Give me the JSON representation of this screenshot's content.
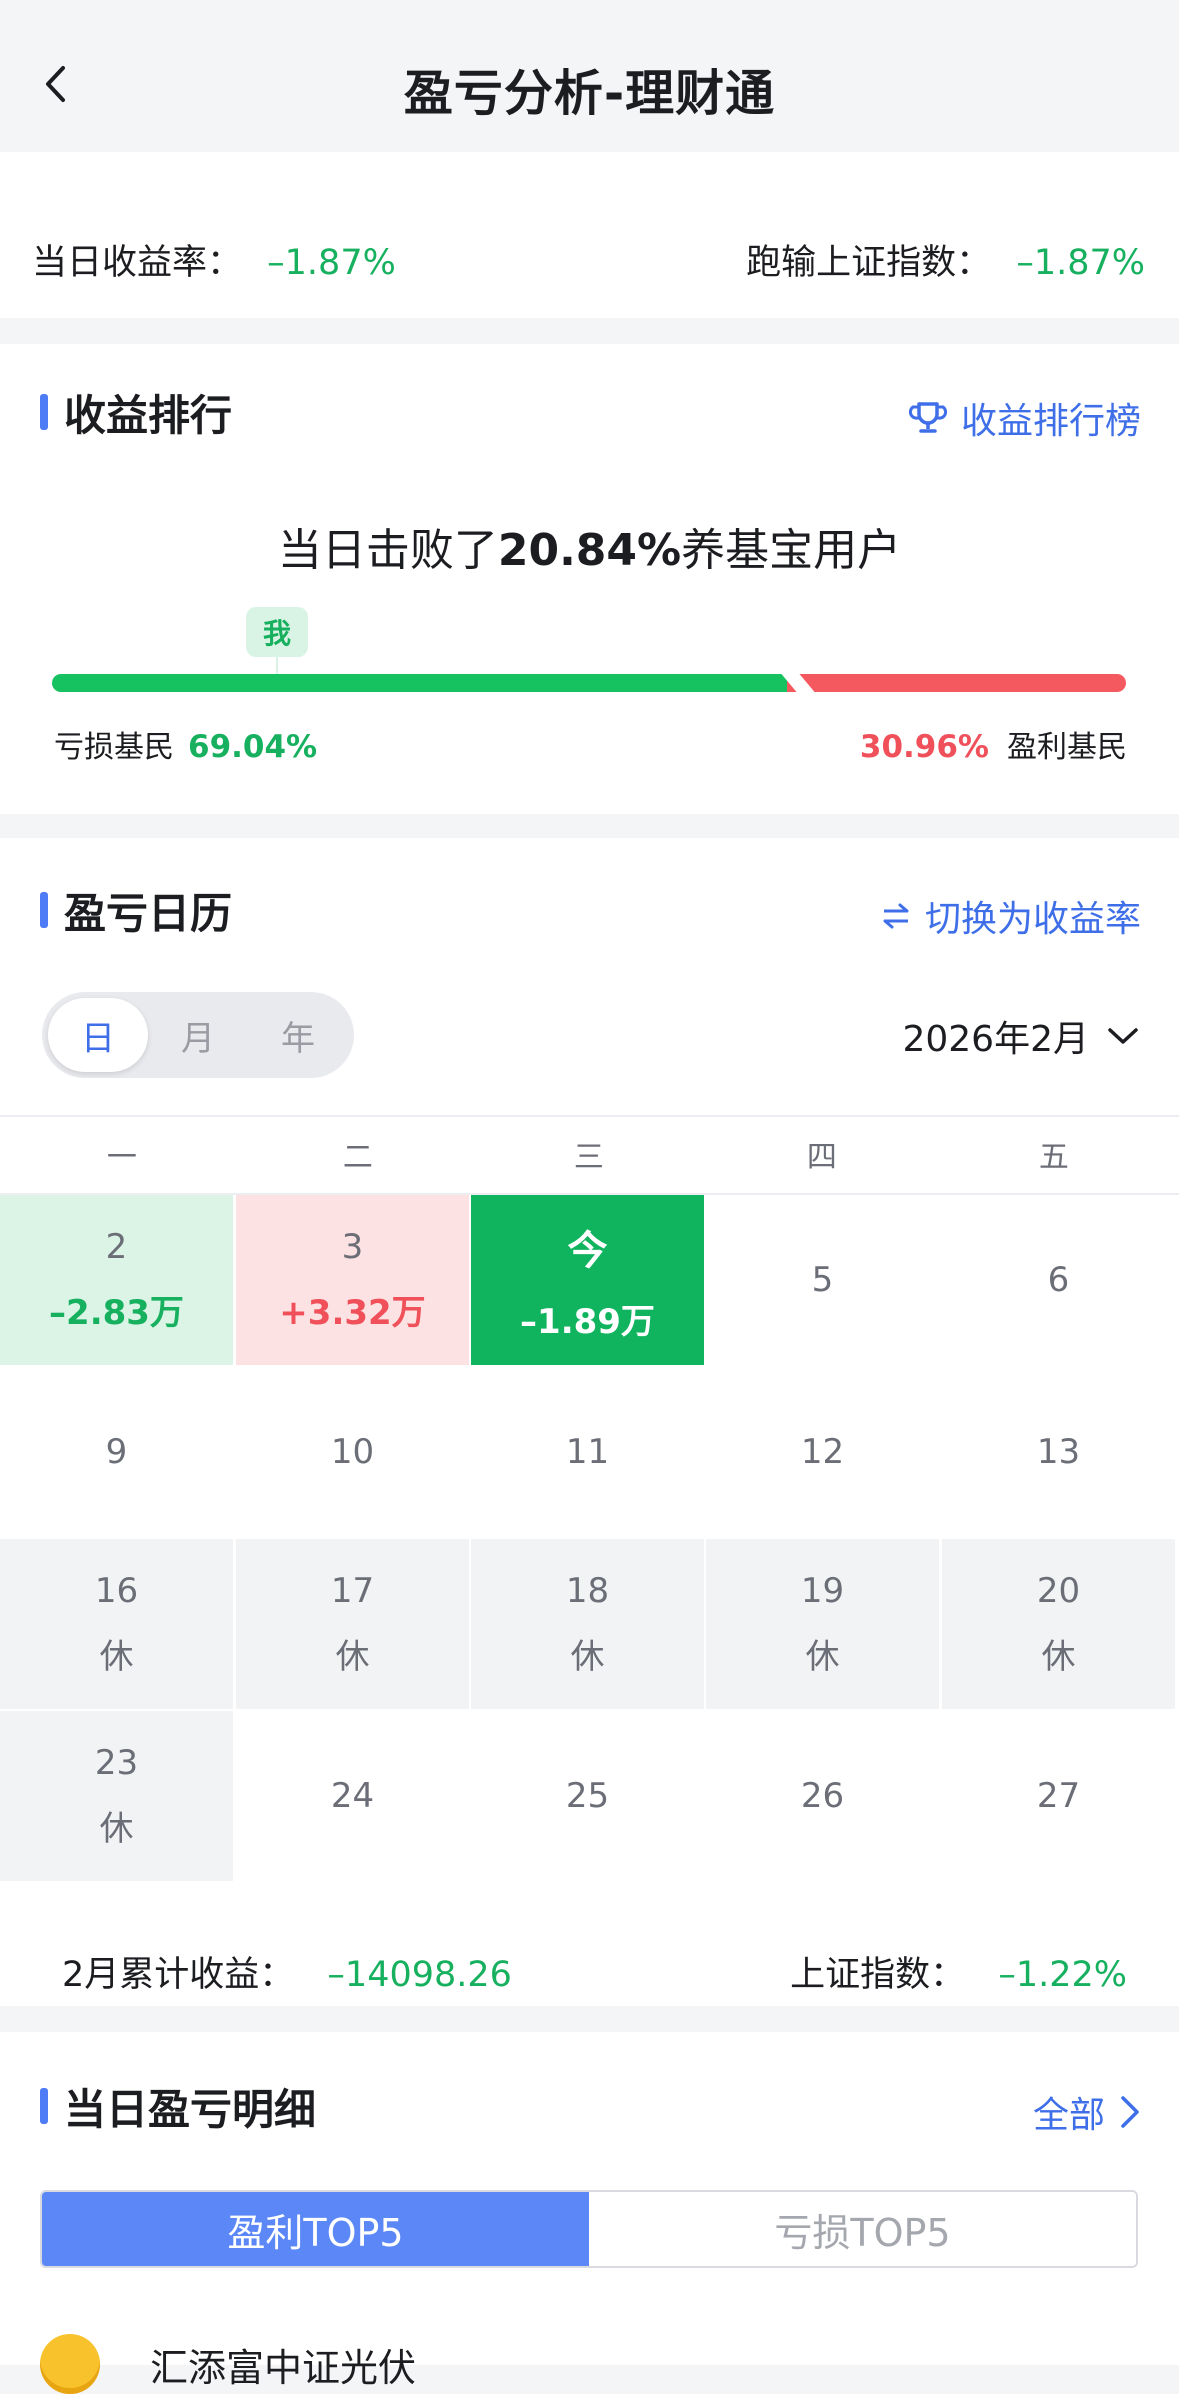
{
  "nav": {
    "title": "盈亏分析-理财通",
    "back_icon": "chevron-left-icon"
  },
  "summary": {
    "daily_rate_label": "当日收益率：",
    "daily_rate_value": "–1.87%",
    "vs_index_label": "跑输上证指数：",
    "vs_index_value": "–1.87%"
  },
  "ranking": {
    "title": "收益排行",
    "link_label": "收益排行榜",
    "link_icon": "trophy-icon",
    "headline_prefix": "当日击败了",
    "headline_percent": "20.84%",
    "headline_suffix": "养基宝用户",
    "me_tag": "我",
    "loss_label": "亏损基民",
    "loss_value": "69.04%",
    "loss_fraction": 0.6904,
    "profit_value": "30.96%",
    "profit_label": "盈利基民",
    "me_fraction": 0.2084
  },
  "calendar": {
    "title": "盈亏日历",
    "switch_label": "切换为收益率",
    "switch_icon": "swap-arrows-icon",
    "modes": [
      "日",
      "月",
      "年"
    ],
    "active_mode": "日",
    "month": "2026年2月",
    "weekdays": [
      "一",
      "二",
      "三",
      "四",
      "五"
    ],
    "weeks": [
      [
        {
          "day": "2",
          "sub": "–2.83万",
          "type": "loss"
        },
        {
          "day": "3",
          "sub": "+3.32万",
          "type": "gain"
        },
        {
          "day": "今",
          "sub": "–1.89万",
          "type": "today"
        },
        {
          "day": "5",
          "sub": "",
          "type": "plain"
        },
        {
          "day": "6",
          "sub": "",
          "type": "plain"
        }
      ],
      [
        {
          "day": "9",
          "sub": "",
          "type": "plain"
        },
        {
          "day": "10",
          "sub": "",
          "type": "plain"
        },
        {
          "day": "11",
          "sub": "",
          "type": "plain"
        },
        {
          "day": "12",
          "sub": "",
          "type": "plain"
        },
        {
          "day": "13",
          "sub": "",
          "type": "plain"
        }
      ],
      [
        {
          "day": "16",
          "sub": "休",
          "type": "rest"
        },
        {
          "day": "17",
          "sub": "休",
          "type": "rest"
        },
        {
          "day": "18",
          "sub": "休",
          "type": "rest"
        },
        {
          "day": "19",
          "sub": "休",
          "type": "rest"
        },
        {
          "day": "20",
          "sub": "休",
          "type": "rest"
        }
      ],
      [
        {
          "day": "23",
          "sub": "休",
          "type": "rest"
        },
        {
          "day": "24",
          "sub": "",
          "type": "plain"
        },
        {
          "day": "25",
          "sub": "",
          "type": "plain"
        },
        {
          "day": "26",
          "sub": "",
          "type": "plain"
        },
        {
          "day": "27",
          "sub": "",
          "type": "plain"
        }
      ]
    ],
    "month_total_label": "2月累计收益：",
    "month_total_value": "–14098.26",
    "index_label": "上证指数：",
    "index_value": "–1.22%"
  },
  "detail": {
    "title": "当日盈亏明细",
    "link_label": "全部",
    "link_icon": "chevron-right-icon",
    "tabs": [
      "盈利TOP5",
      "亏损TOP5"
    ],
    "active_tab": "盈利TOP5",
    "first_fund": "汇添富中证光伏",
    "first_fund_icon": "coin-icon"
  },
  "colors": {
    "accent": "#3f6fe8",
    "loss_green": "#16b05f",
    "gain_red": "#f0505a",
    "today_bg": "#10b45e"
  }
}
